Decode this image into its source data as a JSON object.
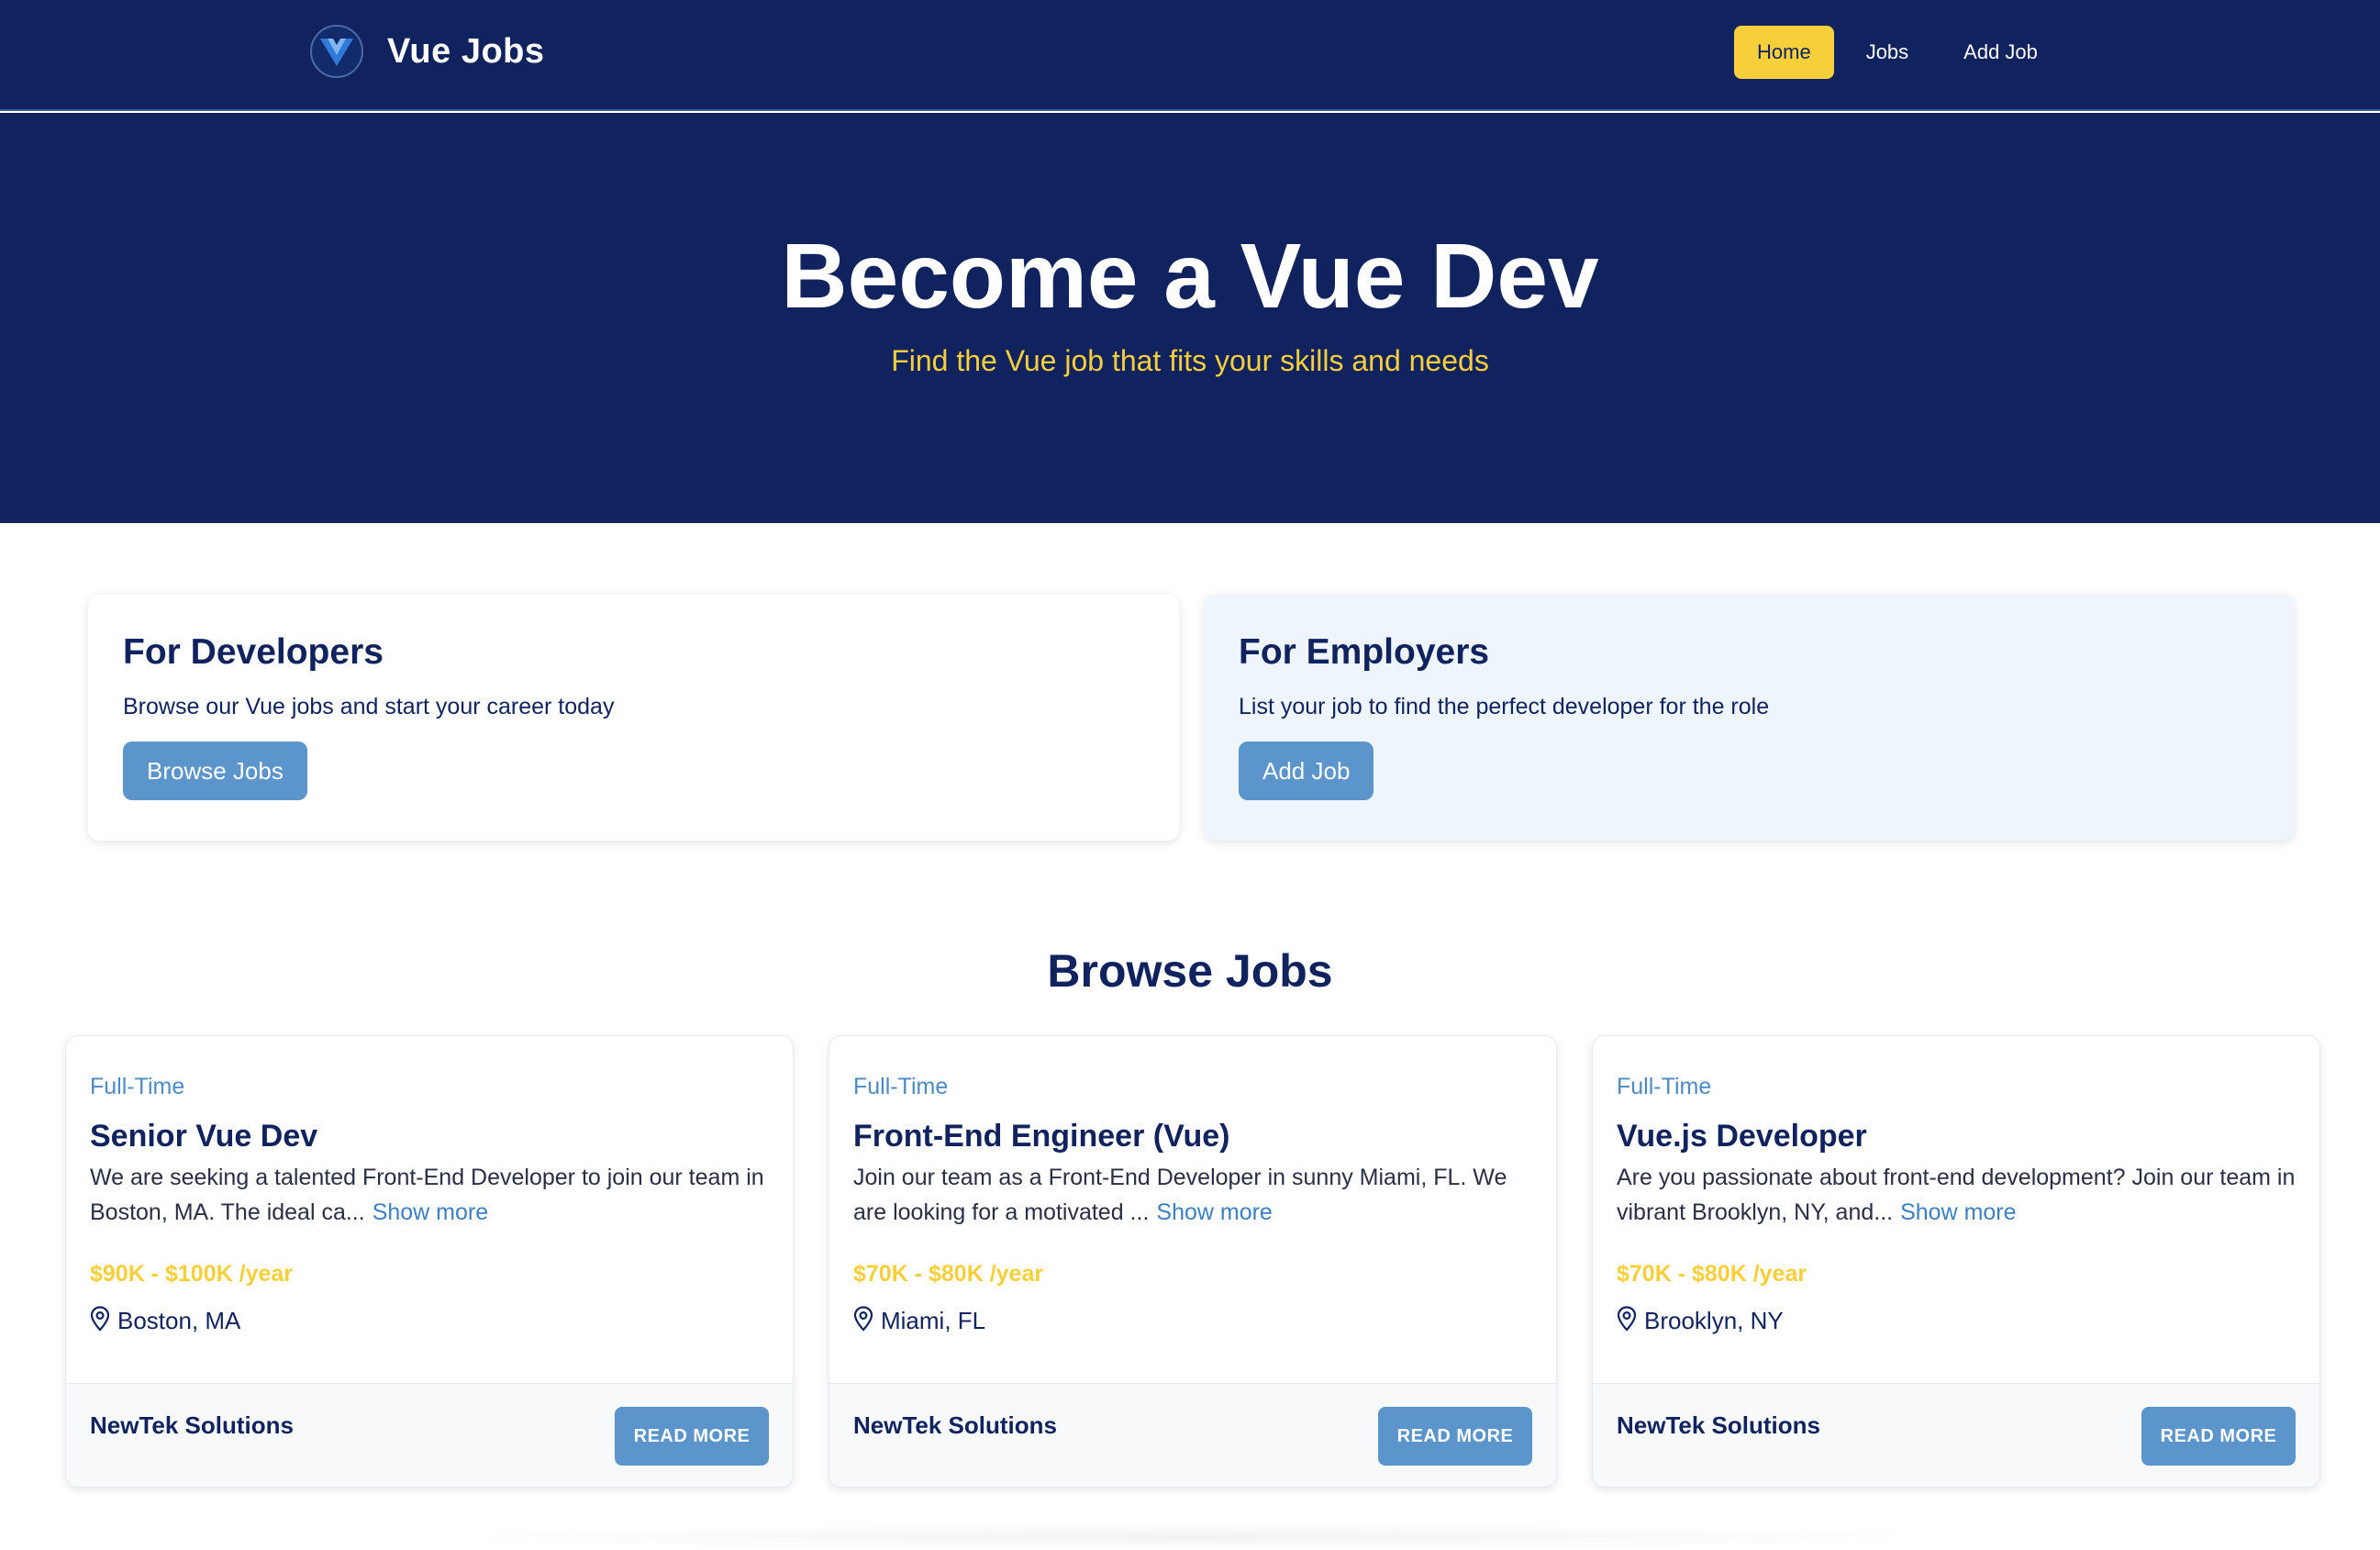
{
  "nav": {
    "brand": "Vue Jobs",
    "links": [
      {
        "label": "Home",
        "active": true
      },
      {
        "label": "Jobs",
        "active": false
      },
      {
        "label": "Add Job",
        "active": false
      }
    ]
  },
  "hero": {
    "title": "Become a Vue Dev",
    "subtitle": "Find the Vue job that fits your skills and needs"
  },
  "cards": {
    "developers": {
      "title": "For Developers",
      "text": "Browse our Vue jobs and start your career today",
      "button": "Browse Jobs"
    },
    "employers": {
      "title": "For Employers",
      "text": "List your job to find the perfect developer for the role",
      "button": "Add Job"
    }
  },
  "browse": {
    "title": "Browse Jobs",
    "jobs": [
      {
        "type": "Full-Time",
        "title": "Senior Vue Dev",
        "description": "We are seeking a talented Front-End Developer to join our team in Boston, MA. The ideal ca...",
        "show_more": "Show more",
        "salary": "$90K - $100K /year",
        "location": "Boston, MA",
        "company": "NewTek Solutions",
        "read_more": "READ MORE"
      },
      {
        "type": "Full-Time",
        "title": "Front-End Engineer (Vue)",
        "description": "Join our team as a Front-End Developer in sunny Miami, FL. We are looking for a motivated ...",
        "show_more": "Show more",
        "salary": "$70K - $80K /year",
        "location": "Miami, FL",
        "company": "NewTek Solutions",
        "read_more": "READ MORE"
      },
      {
        "type": "Full-Time",
        "title": "Vue.js Developer",
        "description": "Are you passionate about front-end development? Join our team in vibrant Brooklyn, NY, and...",
        "show_more": "Show more",
        "salary": "$70K - $80K /year",
        "location": "Brooklyn, NY",
        "company": "NewTek Solutions",
        "read_more": "READ MORE"
      }
    ]
  },
  "colors": {
    "navy": "#10235e",
    "accent_yellow": "#f7cf3a",
    "button_blue": "#5b95cc",
    "employer_bg": "#eef5fd"
  },
  "icons": {
    "logo": "vue-logo-icon",
    "location": "map-pin-icon"
  }
}
